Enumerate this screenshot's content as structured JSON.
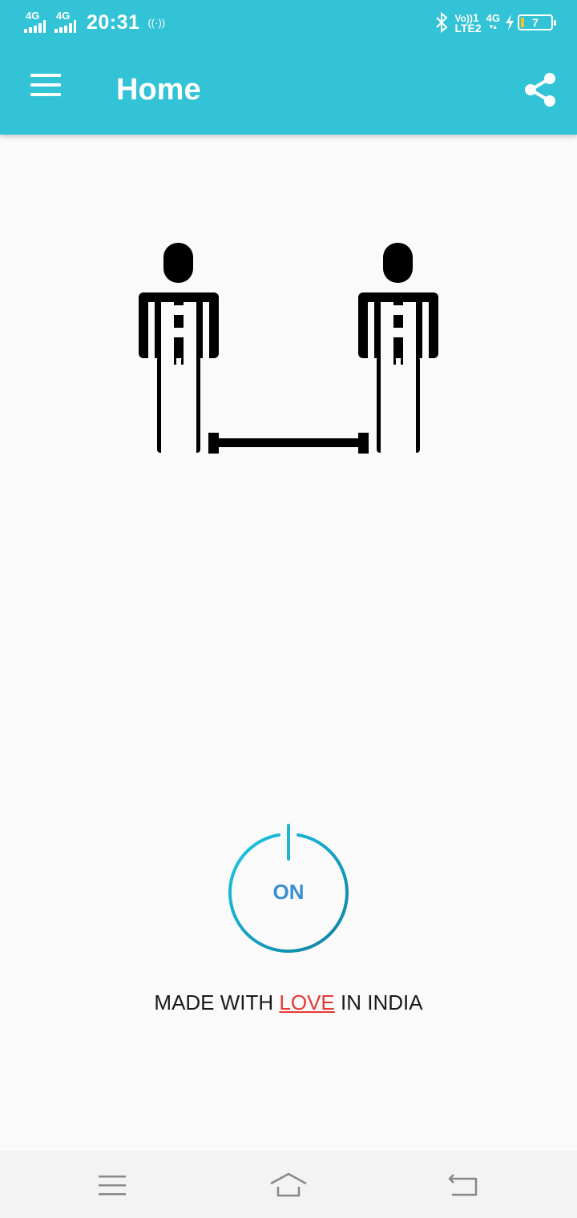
{
  "status_bar": {
    "network1": "4G",
    "network2": "4G",
    "time": "20:31",
    "hotspot": "((·))",
    "volte_top": "Vo))",
    "volte_sim": "1",
    "volte_bottom": "LTE2",
    "data_net": "4G",
    "data_arrows": "▾▴",
    "battery_level": "7",
    "battery_color": "#f5c518"
  },
  "app_bar": {
    "title": "Home",
    "menu_icon": "hamburger-icon",
    "share_icon": "share-icon",
    "background": "#33c3d6"
  },
  "illustration": {
    "icon": "social-distancing-icon"
  },
  "power_button": {
    "label": "ON",
    "state": "on",
    "colors": [
      "#1fc8e3",
      "#0e7fa3"
    ]
  },
  "footer": {
    "prefix": "MADE WITH ",
    "love": "LOVE",
    "suffix": " IN INDIA",
    "love_color": "#e53935"
  },
  "nav_bar": {
    "menu_icon": "recent-apps-icon",
    "home_icon": "home-icon",
    "back_icon": "back-icon"
  }
}
